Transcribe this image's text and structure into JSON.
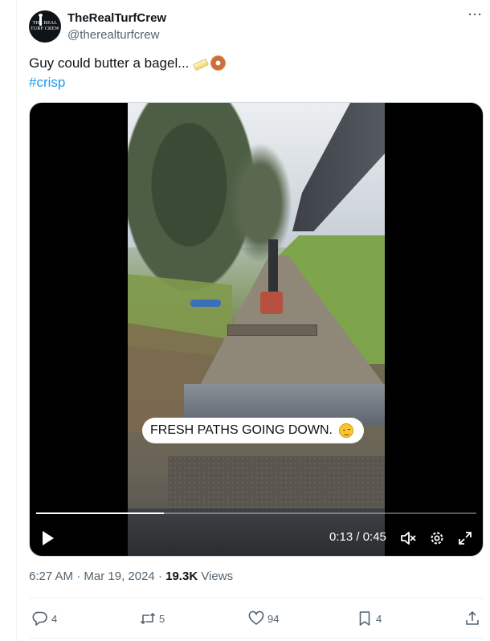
{
  "author": {
    "avatar_text_line1": "THE REAL",
    "avatar_text_line2": "TURF CREW",
    "display_name": "TheRealTurfCrew",
    "handle": "@therealturfcrew"
  },
  "menu": {
    "more_label": "···"
  },
  "tweet": {
    "text": "Guy could butter a bagel...",
    "emojis": [
      "butter-icon",
      "bagel-icon"
    ],
    "hashtag": "#crisp"
  },
  "video": {
    "caption": "FRESH PATHS GOING DOWN.",
    "caption_emoji": "relieved-face-icon",
    "current_time": "0:13",
    "duration": "0:45",
    "time_display": "0:13 / 0:45",
    "progress": 0.29,
    "controls": [
      "play-icon",
      "mute-icon",
      "settings-icon",
      "fullscreen-icon"
    ]
  },
  "meta": {
    "time": "6:27 AM",
    "separator": " · ",
    "date": "Mar 19, 2024",
    "views_count": "19.3K",
    "views_label": " Views"
  },
  "actions": {
    "replies": "4",
    "reposts": "5",
    "likes": "94",
    "bookmarks": "4"
  },
  "colors": {
    "link": "#1d9bf0",
    "secondary": "#536471",
    "primary": "#0f1419"
  }
}
